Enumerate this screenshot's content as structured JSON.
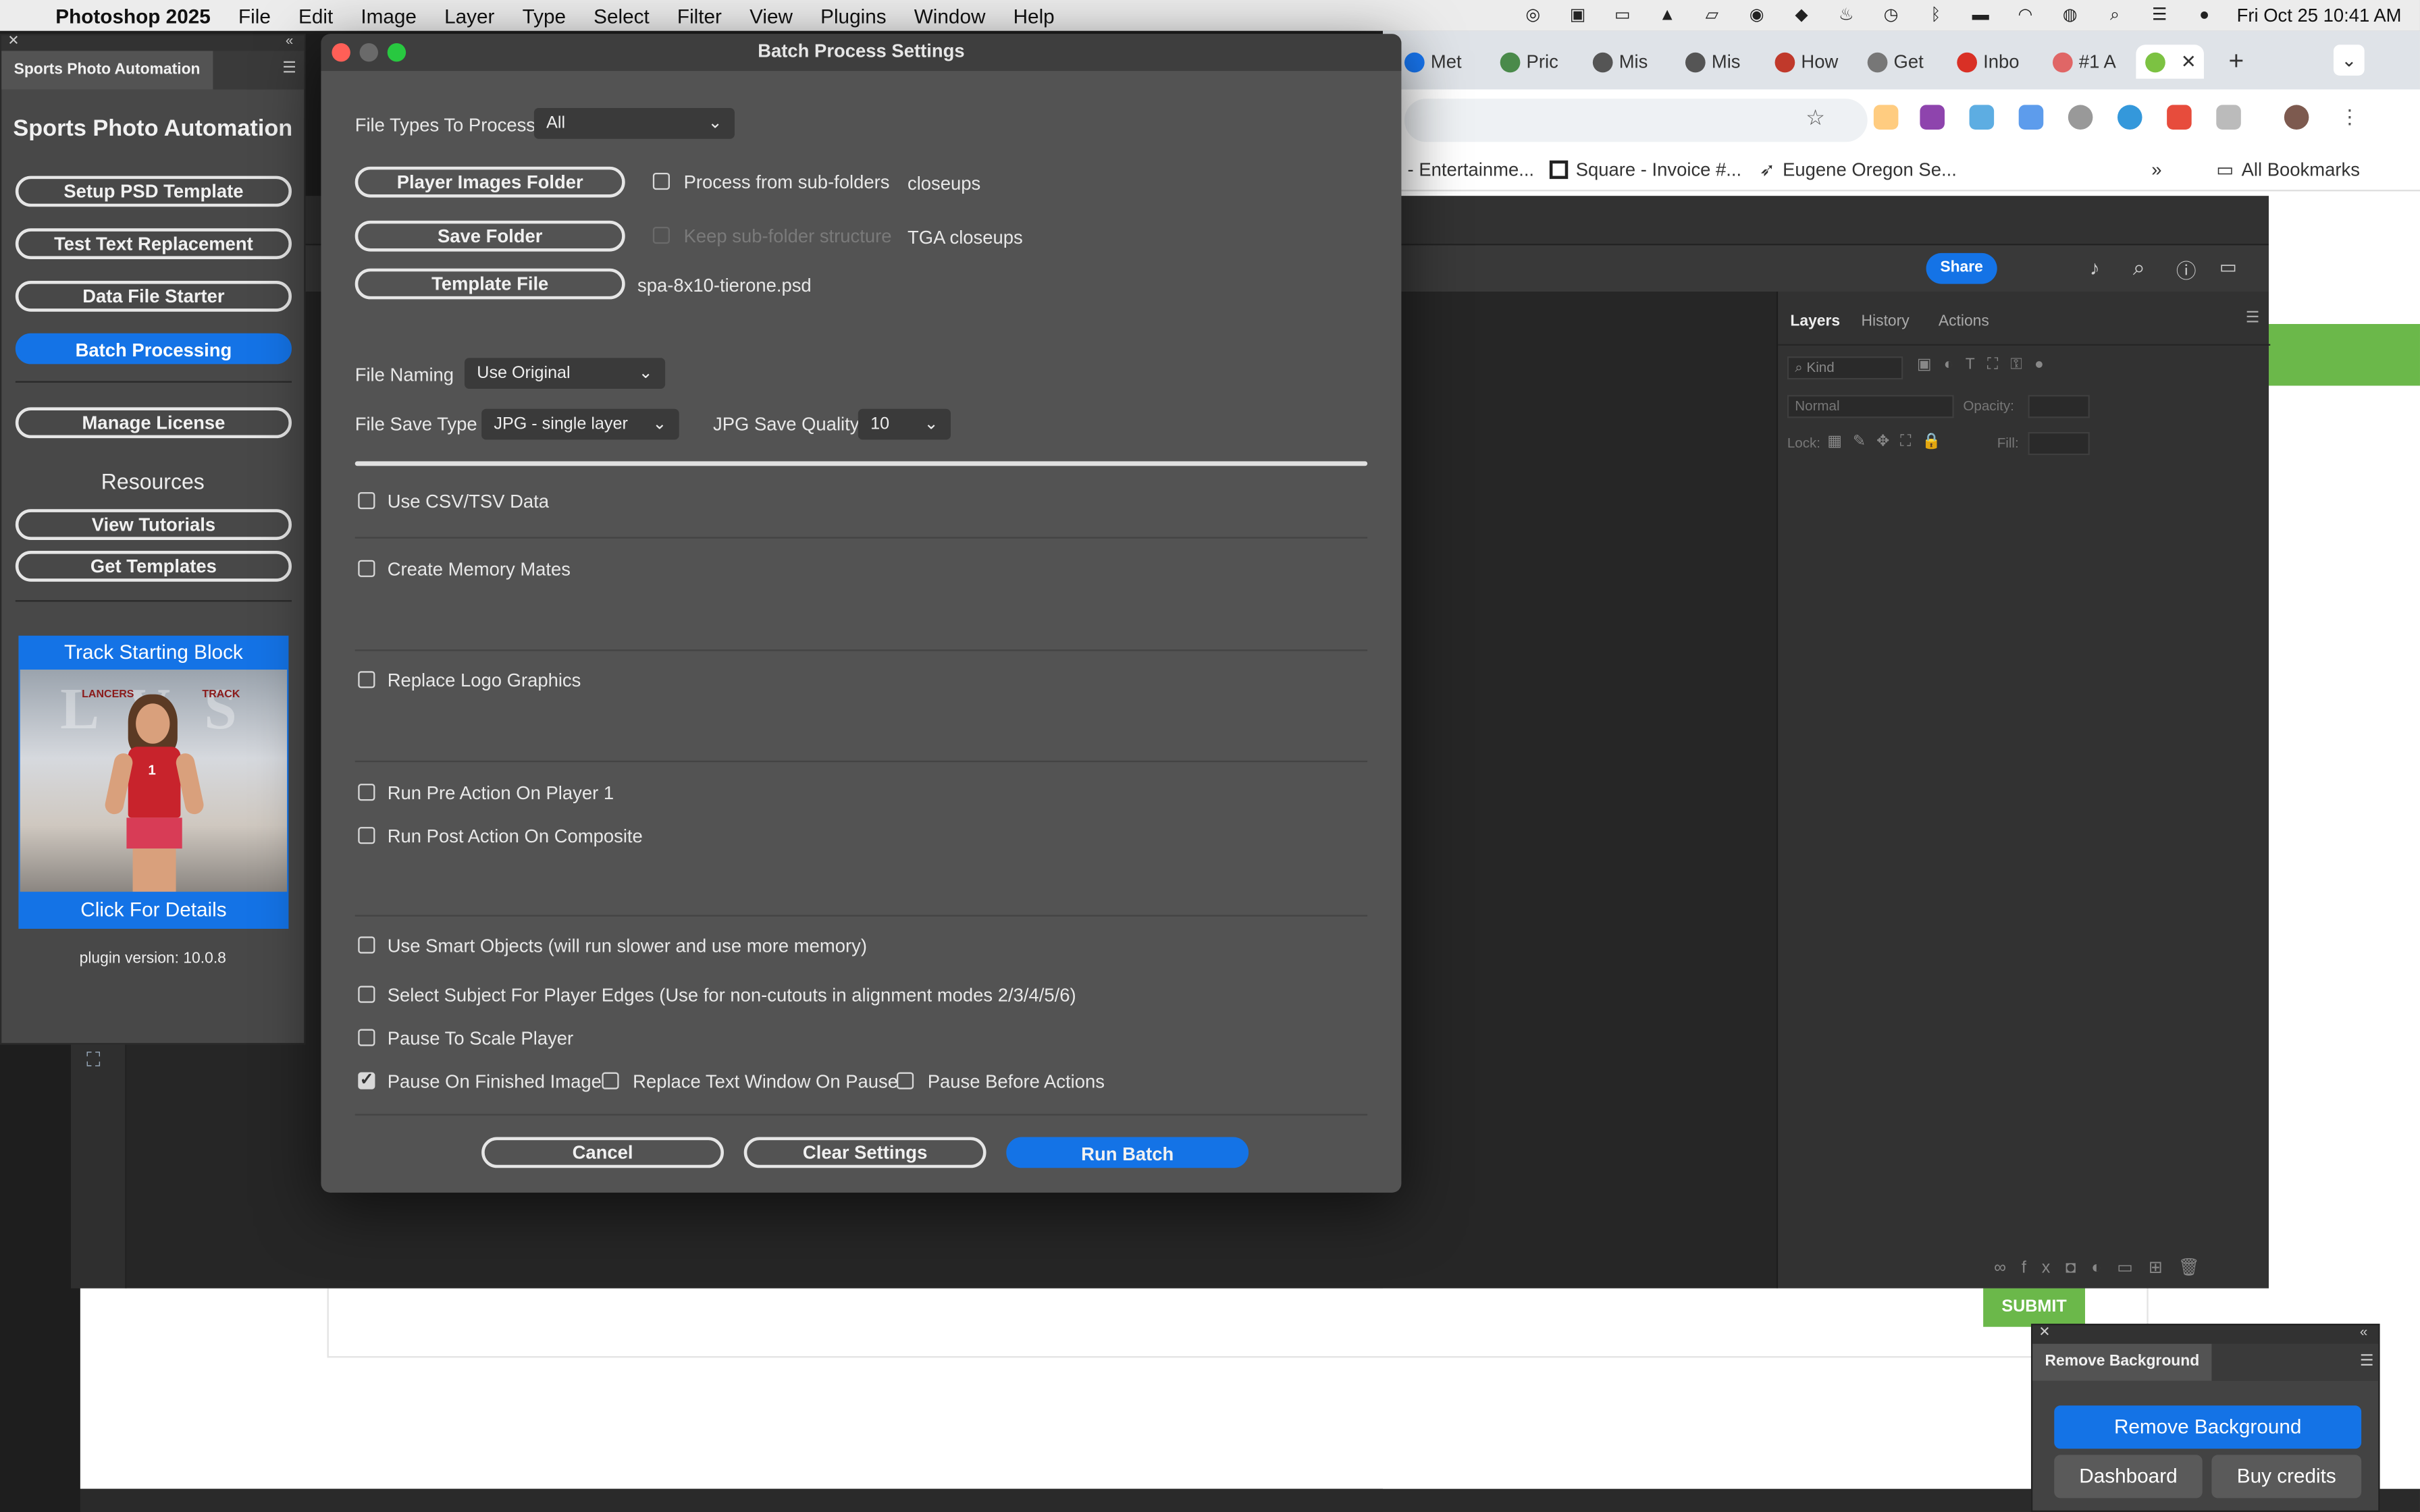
{
  "menubar": {
    "app_name": "Photoshop 2025",
    "items": [
      "File",
      "Edit",
      "Image",
      "Layer",
      "Type",
      "Select",
      "Filter",
      "View",
      "Plugins",
      "Window",
      "Help"
    ],
    "clock": "Fri Oct 25  10:41 AM"
  },
  "browser": {
    "tabs": [
      "Met",
      "Pric",
      "Mis",
      "Mis",
      "How",
      "Get",
      "Inbo",
      "#1 A"
    ],
    "bookmarks": [
      "- Entertainme...",
      "Square - Invoice #...",
      "Eugene Oregon Se..."
    ],
    "all_bookmarks": "All Bookmarks",
    "page_submit": "SUBMIT"
  },
  "photoshop": {
    "share_label": "Share",
    "layers_tabs": [
      "Layers",
      "History",
      "Actions"
    ],
    "kind_label": "Kind",
    "blend_mode": "Normal",
    "opacity_label": "Opacity:",
    "lock_label": "Lock:",
    "fill_label": "Fill:"
  },
  "plugin": {
    "tab_label": "Sports Photo Automation",
    "heading": "Sports Photo Automation",
    "buttons": [
      "Setup PSD Template",
      "Test Text Replacement",
      "Data File Starter",
      "Batch Processing"
    ],
    "manage_license": "Manage License",
    "resources_heading": "Resources",
    "resource_buttons": [
      "View Tutorials",
      "Get Templates"
    ],
    "promo_title": "Track Starting Block",
    "promo_cta": "Click For Details",
    "promo_image_text": {
      "left": "LANCERS",
      "right": "TRACK",
      "bg": "LVS",
      "jersey": "1"
    },
    "version": "plugin version: 10.0.8"
  },
  "dialog": {
    "title": "Batch Process Settings",
    "file_types_label": "File Types To Process",
    "file_types_value": "All",
    "player_images_folder": "Player Images Folder",
    "process_subfolders": "Process from sub-folders",
    "player_images_value": "closeups",
    "save_folder": "Save Folder",
    "keep_subfolder": "Keep sub-folder structure",
    "save_folder_value": "TGA closeups",
    "template_file": "Template File",
    "template_value": "spa-8x10-tierone.psd",
    "file_naming_label": "File Naming",
    "file_naming_value": "Use Original",
    "file_save_type_label": "File Save Type",
    "file_save_type_value": "JPG - single layer",
    "jpg_quality_label": "JPG Save Quality",
    "jpg_quality_value": "10",
    "options": {
      "use_csv": "Use CSV/TSV Data",
      "memory_mates": "Create Memory Mates",
      "replace_logo": "Replace Logo Graphics",
      "pre_action": "Run Pre Action On Player 1",
      "post_action": "Run Post Action On Composite",
      "smart_objects": "Use Smart Objects (will run slower and use more memory)",
      "select_subject": "Select Subject For Player Edges (Use for non-cutouts in alignment modes 2/3/4/5/6)",
      "pause_scale": "Pause To Scale Player",
      "pause_finished": "Pause On Finished Image",
      "replace_text_window": "Replace Text Window On Pause",
      "pause_before_actions": "Pause Before Actions"
    },
    "checked": {
      "pause_finished": true
    },
    "cancel": "Cancel",
    "clear_settings": "Clear Settings",
    "run_batch": "Run Batch"
  },
  "remove_bg": {
    "tab_label": "Remove Background",
    "primary": "Remove Background",
    "dashboard": "Dashboard",
    "buy_credits": "Buy credits"
  },
  "colors": {
    "accent_blue": "#1473e6",
    "promo_blue": "#1473e6",
    "submit_green": "#6bb84a"
  }
}
